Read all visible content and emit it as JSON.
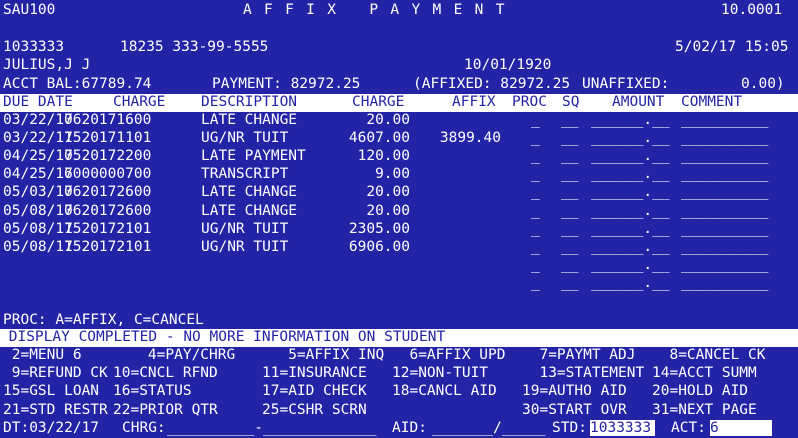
{
  "screen_id": "SAU100",
  "title": "A F F I X   P A Y M E N T",
  "version": "10.0001",
  "student_id": "1033333",
  "student_code_ssn": "18235 333-99-5555",
  "datetime": "5/02/17 15:05",
  "student_name": "JULIUS,J J",
  "birth_date": "10/01/1920",
  "acct_bal": "ACCT BAL:67789.74",
  "payment": "PAYMENT: 82972.25",
  "affixed": "(AFFIXED: 82972.25",
  "unaffixed_label": "UNAFFIXED:",
  "unaffixed_value": "0.00)",
  "columns": {
    "due_date": "DUE DATE",
    "charge_code": "CHARGE",
    "description": "DESCRIPTION",
    "charge_amt": "CHARGE",
    "affix": "AFFIX",
    "proc": "PROC",
    "sq": "SQ",
    "amount": "AMOUNT",
    "comment": "COMMENT"
  },
  "rows": [
    {
      "due_date": "03/22/17",
      "charge_code": "0620171600",
      "description": "LATE CHANGE",
      "charge": "20.00",
      "affix": "",
      "proc": "_",
      "sq": "__",
      "amount": "______.__",
      "comment": "__________"
    },
    {
      "due_date": "03/22/17",
      "charge_code": "1520171101",
      "description": "UG/NR TUIT",
      "charge": "4607.00",
      "affix": "3899.40",
      "proc": "_",
      "sq": "__",
      "amount": "______.__",
      "comment": "__________"
    },
    {
      "due_date": "04/25/17",
      "charge_code": "0520172200",
      "description": "LATE PAYMENT",
      "charge": "120.00",
      "affix": "",
      "proc": "_",
      "sq": "__",
      "amount": "______.__",
      "comment": "__________"
    },
    {
      "due_date": "04/25/17",
      "charge_code": "6000000700",
      "description": "TRANSCRIPT",
      "charge": "9.00",
      "affix": "",
      "proc": "_",
      "sq": "__",
      "amount": "______.__",
      "comment": "__________"
    },
    {
      "due_date": "05/03/17",
      "charge_code": "0620172600",
      "description": "LATE CHANGE",
      "charge": "20.00",
      "affix": "",
      "proc": "_",
      "sq": "__",
      "amount": "______.__",
      "comment": "__________"
    },
    {
      "due_date": "05/08/17",
      "charge_code": "0620172600",
      "description": "LATE CHANGE",
      "charge": "20.00",
      "affix": "",
      "proc": "_",
      "sq": "__",
      "amount": "______.__",
      "comment": "__________"
    },
    {
      "due_date": "05/08/17",
      "charge_code": "1520172101",
      "description": "UG/NR TUIT",
      "charge": "2305.00",
      "affix": "",
      "proc": "_",
      "sq": "__",
      "amount": "______.__",
      "comment": "__________"
    },
    {
      "due_date": "05/08/17",
      "charge_code": "1520172101",
      "description": "UG/NR TUIT",
      "charge": "6906.00",
      "affix": "",
      "proc": "_",
      "sq": "__",
      "amount": "______.__",
      "comment": "__________"
    },
    {
      "due_date": "",
      "charge_code": "",
      "description": "",
      "charge": "",
      "affix": "",
      "proc": "_",
      "sq": "__",
      "amount": "______.__",
      "comment": "__________"
    },
    {
      "due_date": "",
      "charge_code": "",
      "description": "",
      "charge": "",
      "affix": "",
      "proc": "_",
      "sq": "__",
      "amount": "______.__",
      "comment": "__________"
    }
  ],
  "proc_help": "PROC: A=AFFIX, C=CANCEL",
  "message": " DISPLAY COMPLETED - NO MORE INFORMATION ON STUDENT",
  "function_keys": [
    [
      " 2=MENU 6",
      "    4=PAY/CHRG",
      "   5=AFFIX INQ",
      "  6=AFFIX UPD",
      "  7=PAYMT ADJ",
      "  8=CANCEL CK"
    ],
    [
      " 9=REFUND CK",
      "10=CNCL RFND",
      "11=INSURANCE",
      "12=NON-TUIT",
      "  13=STATEMENT",
      "14=ACCT SUMM"
    ],
    [
      "15=GSL LOAN",
      "16=STATUS",
      "17=AID CHECK",
      "18=CANCL AID",
      "19=AUTHO AID",
      "20=HOLD AID"
    ],
    [
      "21=STD RESTR",
      "22=PRIOR QTR",
      "25=CSHR SCRN",
      "",
      "30=START OVR",
      "31=NEXT PAGE"
    ]
  ],
  "bottom": {
    "dt_label": "DT:03/22/17",
    "chrg_label": "CHRG:",
    "chrg_value": "__________-_____________",
    "aid_label": "AID:",
    "aid_value": "_______/_____",
    "std_label": "STD:",
    "std_value": "1033333",
    "act_label": "ACT:",
    "act_value": "6"
  },
  "colors": {
    "background": "#2323a6",
    "foreground": "#ffffff"
  }
}
